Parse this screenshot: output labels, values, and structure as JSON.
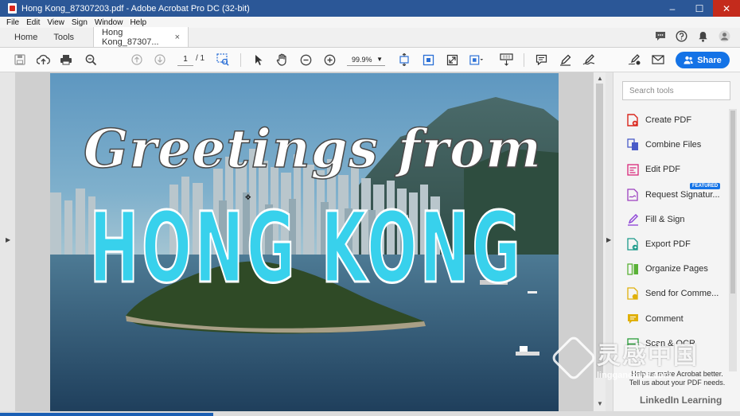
{
  "window": {
    "title": "Hong Kong_87307203.pdf - Adobe Acrobat Pro DC (32-bit)",
    "controls": [
      "–",
      "☐",
      "✕"
    ]
  },
  "menu": [
    "File",
    "Edit",
    "View",
    "Sign",
    "Window",
    "Help"
  ],
  "tabs": {
    "home": "Home",
    "tools": "Tools",
    "doc": "Hong Kong_87307...",
    "close": "×"
  },
  "toolbar": {
    "page_current": "1",
    "page_total": "/ 1",
    "zoom": "99.9%",
    "share_label": "Share"
  },
  "document": {
    "line1": "Greetings from",
    "line2": "HONG KONG"
  },
  "right_panel": {
    "search_placeholder": "Search tools",
    "tools": [
      {
        "label": "Create PDF",
        "icon": "create-pdf-icon",
        "color": "#d9261c"
      },
      {
        "label": "Combine Files",
        "icon": "combine-files-icon",
        "color": "#4a5cc8"
      },
      {
        "label": "Edit PDF",
        "icon": "edit-pdf-icon",
        "color": "#d9267a"
      },
      {
        "label": "Request Signatur...",
        "icon": "request-signature-icon",
        "color": "#9c3fbf"
      },
      {
        "label": "Fill & Sign",
        "icon": "fill-sign-icon",
        "color": "#8b3fd6"
      },
      {
        "label": "Export PDF",
        "icon": "export-pdf-icon",
        "color": "#1b9a8a"
      },
      {
        "label": "Organize Pages",
        "icon": "organize-pages-icon",
        "color": "#5ab237"
      },
      {
        "label": "Send for Comme...",
        "icon": "send-for-comment-icon",
        "color": "#e0b00a"
      },
      {
        "label": "Comment",
        "icon": "comment-icon",
        "color": "#e0b00a"
      },
      {
        "label": "Scan & OCR",
        "icon": "scan-ocr-icon",
        "color": "#2a9d3a"
      }
    ],
    "featured_badge": "FEATURED",
    "promo_line1": "Help us make Acrobat better.",
    "promo_line2": "Tell us about your PDF needs."
  },
  "watermark": {
    "logo_text": "灵感中国",
    "sub": "lingganchina.com",
    "linkedin": "LinkedIn Learning"
  }
}
